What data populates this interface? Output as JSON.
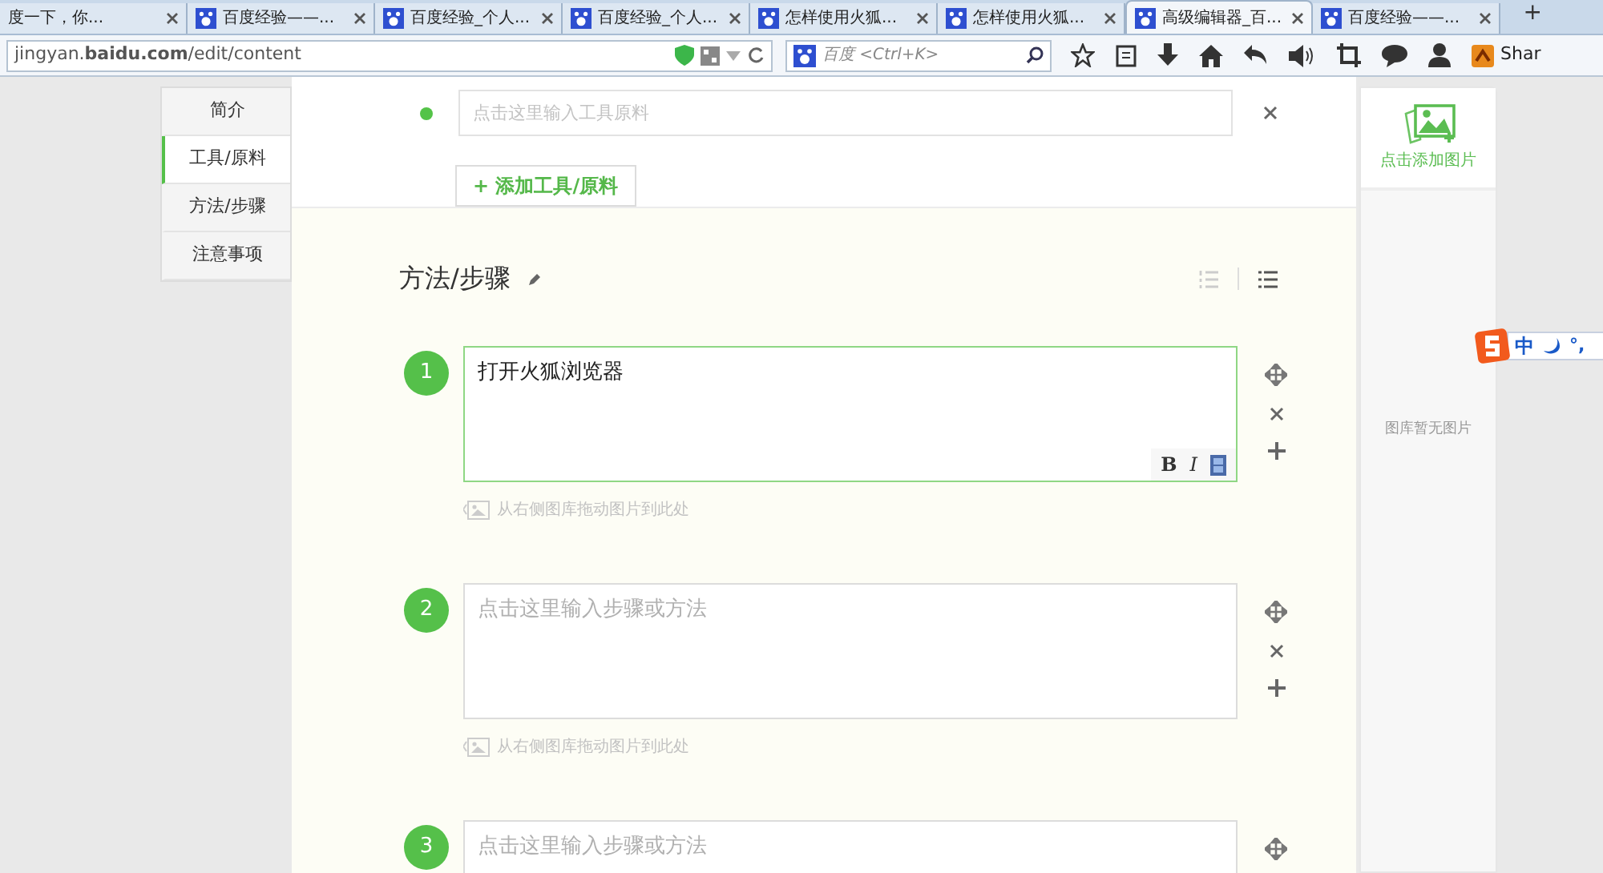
{
  "browser": {
    "tabs": [
      {
        "title": "度一下，你...",
        "selected": false
      },
      {
        "title": "百度经验——...",
        "selected": false
      },
      {
        "title": "百度经验_个人...",
        "selected": false
      },
      {
        "title": "百度经验_个人...",
        "selected": false
      },
      {
        "title": "怎样使用火狐...",
        "selected": false
      },
      {
        "title": "怎样使用火狐...",
        "selected": false
      },
      {
        "title": "高级编辑器_百...",
        "selected": true
      },
      {
        "title": "百度经验——...",
        "selected": false
      }
    ],
    "new_tab": "+",
    "url": "jingyan.**baidu.com**/edit/content",
    "search_placeholder": "百度 <Ctrl+K>",
    "toolbar_text": "Shar"
  },
  "sidebar": {
    "items": [
      {
        "label": "简介",
        "selected": false
      },
      {
        "label": "工具/原料",
        "selected": true
      },
      {
        "label": "方法/步骤",
        "selected": false
      },
      {
        "label": "注意事项",
        "selected": false
      }
    ]
  },
  "tools": {
    "input_placeholder": "点击这里输入工具原料",
    "add_button": "+ 添加工具/原料"
  },
  "steps_section": {
    "title": "方法/步骤",
    "steps": [
      {
        "number": "1",
        "value": "打开火狐浏览器",
        "selected": true,
        "format_buttons": [
          "B",
          "I"
        ],
        "hint": "从右侧图库拖动图片到此处"
      },
      {
        "number": "2",
        "placeholder": "点击这里输入步骤或方法",
        "selected": false,
        "hint": "从右侧图库拖动图片到此处"
      },
      {
        "number": "3",
        "placeholder": "点击这里输入步骤或方法",
        "selected": false
      }
    ]
  },
  "gallery": {
    "add_label": "点击添加图片",
    "empty_text": "图库暂无图片"
  },
  "ime": {
    "mode": "中",
    "punctuation": "°,"
  }
}
